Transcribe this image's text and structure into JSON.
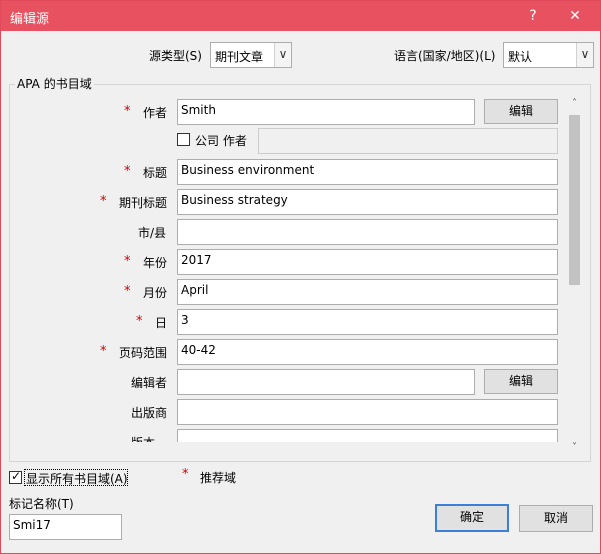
{
  "window": {
    "title": "编辑源",
    "help_glyph": "?",
    "close_glyph": "✕"
  },
  "source_type": {
    "label": "源类型(S)",
    "value": "期刊文章",
    "arrow": "∨"
  },
  "language": {
    "label": "语言(国家/地区)(L)",
    "value": "默认",
    "arrow": "∨"
  },
  "group": {
    "title": "APA 的书目域"
  },
  "required_mark": "*",
  "fields": {
    "author": {
      "label": "作者",
      "value": "Smith",
      "edit_button": "编辑"
    },
    "corporate_author": {
      "label": "公司 作者",
      "checked": false,
      "value": ""
    },
    "title": {
      "label": "标题",
      "value": "Business environment"
    },
    "journal_name": {
      "label": "期刊标题",
      "value": "Business  strategy"
    },
    "city": {
      "label": "市/县",
      "value": ""
    },
    "year": {
      "label": "年份",
      "value": "2017"
    },
    "month": {
      "label": "月份",
      "value": "April"
    },
    "day": {
      "label": "日",
      "value": "3"
    },
    "pages": {
      "label": "页码范围",
      "value": "40-42"
    },
    "editor": {
      "label": "编辑者",
      "value": "",
      "edit_button": "编辑"
    },
    "publisher": {
      "label": "出版商",
      "value": ""
    },
    "volume": {
      "label": "版本",
      "value": ""
    }
  },
  "scrollbar": {
    "up_glyph": "˄",
    "down_glyph": "˅"
  },
  "show_all_fields": {
    "label": "显示所有书目域(A)",
    "checked": true
  },
  "recommended_legend": {
    "mark": "*",
    "label": "推荐域"
  },
  "tag_name": {
    "label": "标记名称(T)",
    "value": "Smi17"
  },
  "buttons": {
    "ok": "确定",
    "cancel": "取消"
  }
}
